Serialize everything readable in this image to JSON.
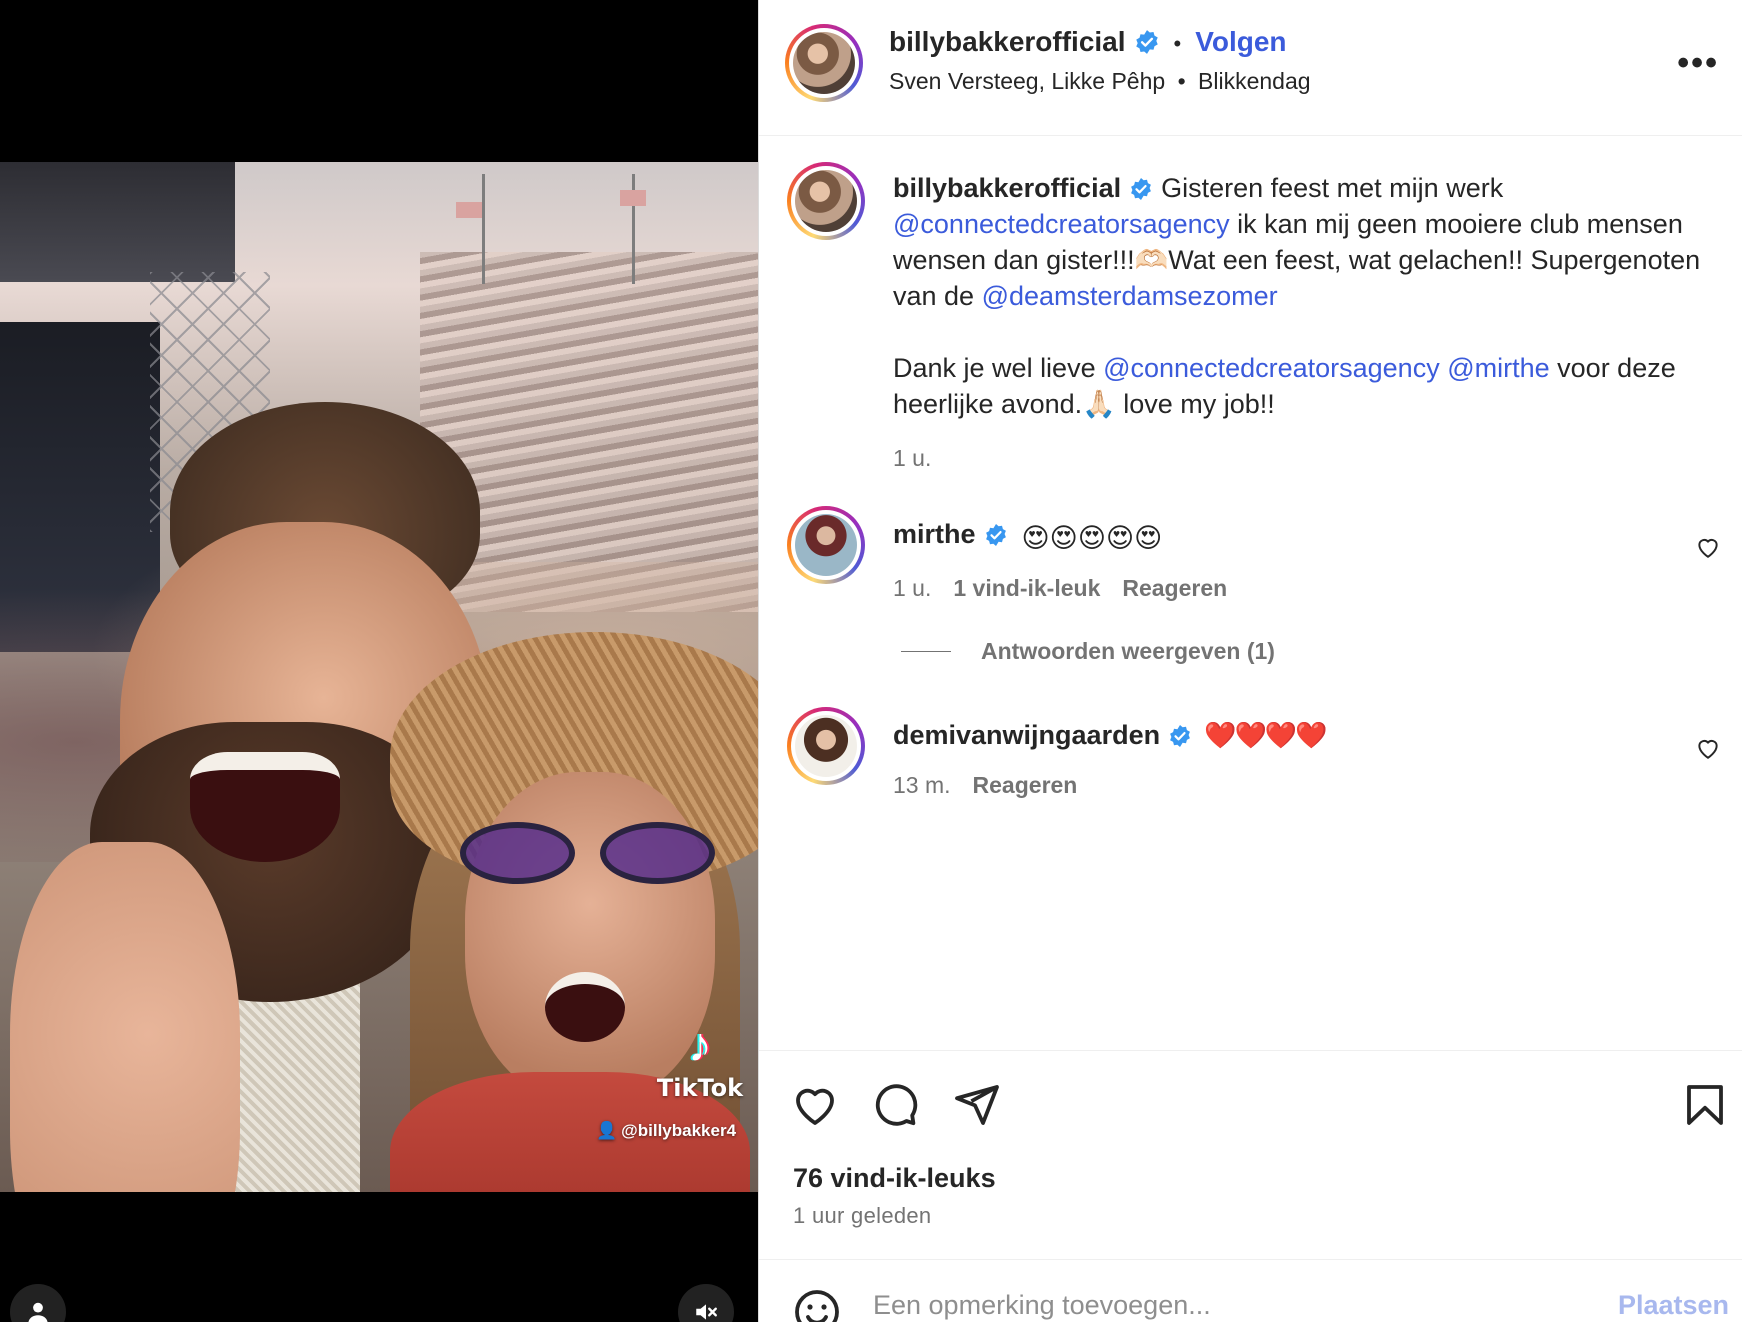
{
  "post": {
    "author": "billybakkerofficial",
    "follow_label": "Volgen",
    "separator": "•",
    "more_label": "•••",
    "subline": {
      "tagged": "Sven Versteeg, Likke Pêhp",
      "separator": "•",
      "location": "Blikkendag"
    }
  },
  "media": {
    "watermark_brand": "TikTok",
    "watermark_user": "@billybakker4",
    "icons": {
      "tag": "user-tag-icon",
      "mute": "speaker-muted-icon",
      "watermark": "tiktok-logo-icon"
    }
  },
  "caption": {
    "author": "billybakkerofficial",
    "line1_text": "Gisteren feest met mijn werk",
    "mention1": "@connectedcreatorsagency",
    "line2_text": " ik kan mij geen mooiere club mensen wensen dan gister!!!🫶🏻Wat een feest, wat gelachen!! Supergenoten van de ",
    "mention2": "@deamsterdamsezomer",
    "line3_text": "Dank je wel lieve ",
    "mention3": "@connectedcreatorsagency",
    "mention4": "@mirthe",
    "line4_text": " voor deze heerlijke avond.🙏🏻 love my job!!",
    "time": "1 u."
  },
  "comments": [
    {
      "author": "mirthe",
      "text": "😍😍😍😍😍",
      "time": "1 u.",
      "likes": "1 vind-ik-leuk",
      "reply": "Reageren"
    },
    {
      "author": "demivanwijngaarden",
      "text": "❤️❤️❤️❤️",
      "time": "13 m.",
      "reply": "Reageren"
    }
  ],
  "view_replies": "Antwoorden weergeven (1)",
  "stats": {
    "likes": "76 vind-ik-leuks",
    "time": "1 uur geleden"
  },
  "composer": {
    "placeholder": "Een opmerking toevoegen...",
    "post_label": "Plaatsen"
  },
  "colors": {
    "accent": "#3b5bdb",
    "verified": "#3897f0",
    "text": "#262626",
    "muted": "#737373"
  }
}
